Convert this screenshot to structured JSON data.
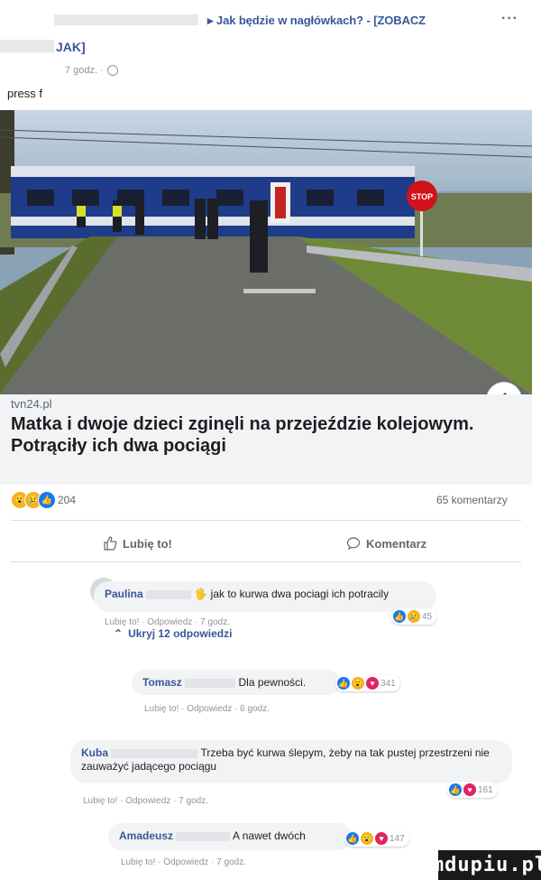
{
  "header": {
    "title_line1": "▸ Jak będzie w nagłówkach? - [ZOBACZ",
    "title_line2": "JAK]",
    "time": "7 godz. ·",
    "more": "···",
    "post_text": "press f"
  },
  "link": {
    "domain": "tvn24.pl",
    "title": "Matka i dwoje dzieci zginęli na przejeździe kolejowym. Potrąciły ich dwa pociągi",
    "info_label": "i"
  },
  "reactions": {
    "count": "204",
    "comments_count": "65 komentarzy"
  },
  "actions": {
    "like_label": "Lubię to!",
    "comment_label": "Komentarz"
  },
  "comments": [
    {
      "author": "Paulina",
      "text": "🖐 jak to kurwa dwa pociagi ich potracily",
      "meta": "Lubię to! · Odpowiedz · 7 godz.",
      "reactions": "45"
    },
    {
      "author": "Tomasz",
      "text": "Dla pewności.",
      "meta": "Lubię to! · Odpowiedz · 6 godz.",
      "reactions": "341"
    },
    {
      "author": "Kuba",
      "text": "Trzeba być kurwa ślepym, żeby na tak pustej przestrzeni nie zauważyć jadącego pociągu",
      "meta": "Lubię to! · Odpowiedz · 7 godz.",
      "reactions": "161"
    },
    {
      "author": "Amadeusz",
      "text": "A nawet dwóch",
      "meta": "Lubię to! · Odpowiedz · 7 godz.",
      "reactions": "147"
    }
  ],
  "replies_toggle": "Ukryj 12 odpowiedzi",
  "watermark": "mdupiu.pl",
  "colors": {
    "link_blue": "#385898",
    "like_blue": "#1877f2",
    "love_red": "#e0245e",
    "haha_yellow": "#f7b125"
  }
}
